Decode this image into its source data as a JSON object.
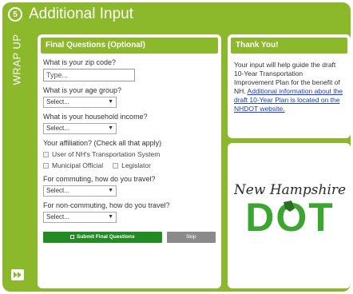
{
  "header": {
    "step_number": "5",
    "title": "Additional Input",
    "side_label": "WRAP UP"
  },
  "form": {
    "heading": "Final Questions (Optional)",
    "zip_label": "What is your zip code?",
    "zip_placeholder": "Type...",
    "age_label": "What is your age group?",
    "age_value": "Select...",
    "income_label": "What is your household income?",
    "income_value": "Select...",
    "affiliation_label": "Your affiliation? (Check all that apply)",
    "affiliations": [
      "User of NH's Transportation System",
      "Municipal Official",
      "Legislator"
    ],
    "commute_label": "For commuting, how do you travel?",
    "commute_value": "Select...",
    "noncommute_label": "For non-commuting, how do you travel?",
    "noncommute_value": "Select...",
    "submit_label": "Submit Final Questions",
    "skip_label": "Skip"
  },
  "thanks": {
    "heading": "Thank You!",
    "body": "Your input will help guide the draft 10-Year Transportation Improvement Plan for the benefit of NH.",
    "link": "Additional information about the draft 10-Year Plan is located on the NHDOT website."
  },
  "logo": {
    "script_text": "New Hampshire",
    "block_text": "DOT"
  },
  "colors": {
    "frame_green": "#8cb82b",
    "logo_green": "#3aa62f",
    "button_green": "#228b22",
    "link_blue": "#1a3ec8"
  }
}
